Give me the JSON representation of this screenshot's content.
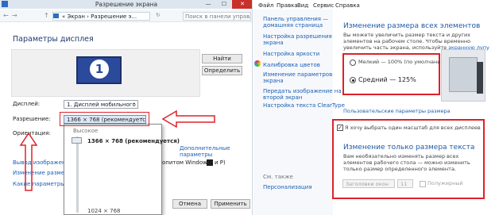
{
  "left_window": {
    "title": "Разрешение экрана",
    "controls": {
      "minimize": "—",
      "maximize": "☐",
      "close": "✕"
    },
    "nav": {
      "back": "←",
      "forward": "→",
      "up": "↑"
    },
    "breadcrumb": "« Экран › Разрешение э...",
    "refresh": "↻",
    "search_placeholder": "Поиск в панели управления",
    "heading": "Параметры дисплея",
    "monitor_number": "1",
    "find_label": "Найти",
    "identify_label": "Определить",
    "display_label": "Дисплей:",
    "display_value": "1. Дисплей мобильного ПК",
    "resolution_label": "Разрешение:",
    "resolution_value": "1366 × 768 (рекомендуется)",
    "orientation_label": "Ориентация:",
    "advanced_link": "Дополнительные параметры",
    "link1": "Вывод изображения на",
    "link1_tail": "опитом Windows",
    "link1_end": "и Р)",
    "link2": "Изменение размеров т",
    "link3": "Какие параметры мони",
    "dropdown": {
      "high": "Высокое",
      "current": "1366 × 768 (рекомендуется)",
      "low": "1024 × 768"
    },
    "buttons": {
      "cancel": "Отмена",
      "apply": "Применить"
    }
  },
  "right_window": {
    "menu": [
      "Файл",
      "Правка",
      "Вид",
      "Сервис",
      "Справка"
    ],
    "sidebar_links": [
      "Панель управления —",
      "домашняя страница",
      "Настройка разрешения",
      "экрана",
      "Настройка яркости",
      "Калибровка цветов",
      "Изменение параметров",
      "экрана",
      "Передать изображение на",
      "второй экран",
      "Настройка текста ClearType"
    ],
    "see_also": "См. также",
    "personalization": "Персонализация",
    "heading1": "Изменение размера всех элементов",
    "desc1": "Вы можете увеличить размер текста и других элементов на рабочем столе. Чтобы временно увеличить часть экрана, используйте",
    "magnifier_link": "экранную лупу",
    "option_small": "Мелкий — 100% (по умолчанию)",
    "option_medium": "Средний — 125%",
    "custom_link": "Пользовательские параметры размера",
    "checkbox_label": "Я хочу выбрать один масштаб для всех дисплеев",
    "checkbox_mark": "✓",
    "heading2": "Изменение только размера текста",
    "desc2": "Вам необязательно изменять размер всех элементов рабочего стола — можно изменить только размер определенного элемента.",
    "element_combo": "Заголовки окон",
    "size_combo": "11",
    "bold_label": "Полужирный"
  },
  "colors": {
    "annotation": "#e0202a",
    "link": "#1a5fb4",
    "heading": "#1e5aa6"
  }
}
